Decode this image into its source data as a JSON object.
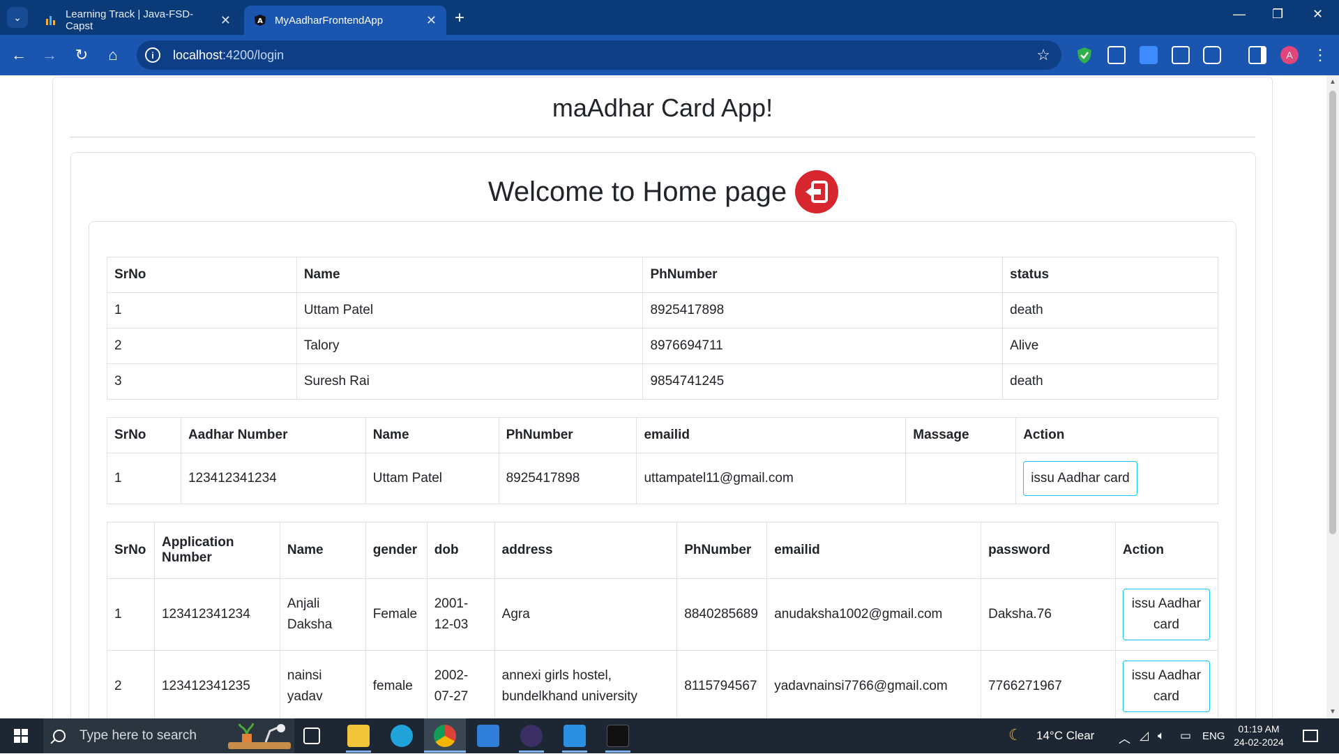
{
  "browser": {
    "tabs": [
      {
        "title": "Learning Track | Java-FSD-Capst",
        "active": false
      },
      {
        "title": "MyAadharFrontendApp",
        "active": true
      }
    ],
    "url_host": "localhost",
    "url_path": ":4200/login",
    "profile_initial": "A"
  },
  "page": {
    "app_title": "maAdhar Card App!",
    "welcome": "Welcome to Home page"
  },
  "table_status": {
    "headers": [
      "SrNo",
      "Name",
      "PhNumber",
      "status"
    ],
    "rows": [
      [
        "1",
        "Uttam Patel",
        "8925417898",
        "death"
      ],
      [
        "2",
        "Talory",
        "8976694711",
        "Alive"
      ],
      [
        "3",
        "Suresh Rai",
        "9854741245",
        "death"
      ]
    ]
  },
  "table_issue": {
    "headers": [
      "SrNo",
      "Aadhar Number",
      "Name",
      "PhNumber",
      "emailid",
      "Massage",
      "Action"
    ],
    "rows": [
      [
        "1",
        "123412341234",
        "Uttam Patel",
        "8925417898",
        "uttampatel11@gmail.com",
        "",
        "issu Aadhar card"
      ]
    ]
  },
  "table_applications": {
    "headers": [
      "SrNo",
      "Application Number",
      "Name",
      "gender",
      "dob",
      "address",
      "PhNumber",
      "emailid",
      "password",
      "Action"
    ],
    "rows": [
      [
        "1",
        "123412341234",
        "Anjali Daksha",
        "Female",
        "2001-12-03",
        "Agra",
        "8840285689",
        "anudaksha1002@gmail.com",
        "Daksha.76",
        "issu Aadhar card"
      ],
      [
        "2",
        "123412341235",
        "nainsi yadav",
        "female",
        "2002-07-27",
        "annexi girls hostel, bundelkhand university",
        "8115794567",
        "yadavnainsi7766@gmail.com",
        "7766271967",
        "issu Aadhar card"
      ]
    ]
  },
  "taskbar": {
    "search_placeholder": "Type here to search",
    "weather": "14°C  Clear",
    "language": "ENG",
    "time": "01:19 AM",
    "date": "24-02-2024"
  }
}
